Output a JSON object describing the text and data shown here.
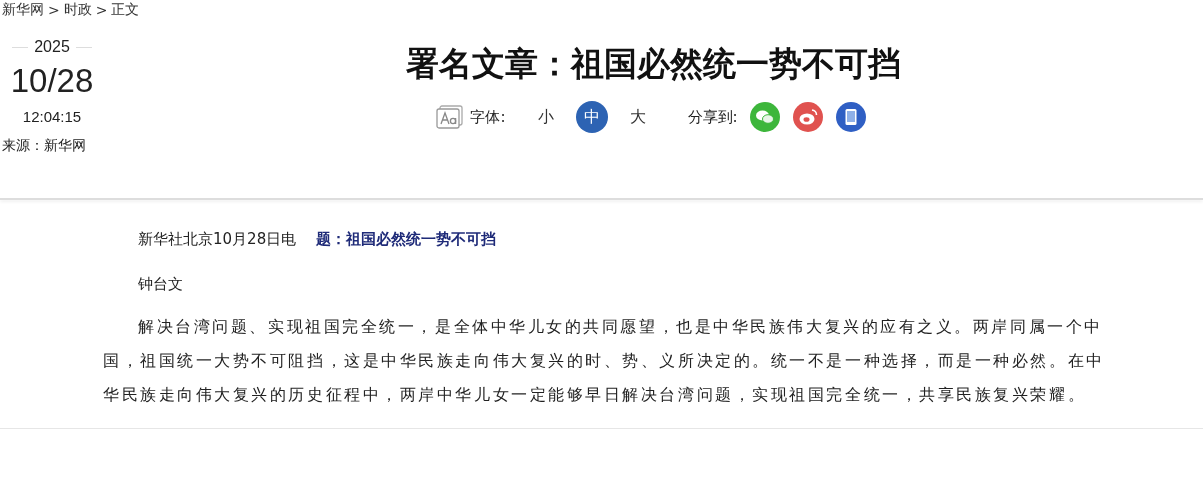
{
  "breadcrumb": [
    "新华网",
    "时政",
    "正文"
  ],
  "breadcrumb_separator": ">",
  "date": {
    "year": "2025",
    "day": "10/28",
    "time": "12:04:15",
    "source": "来源：新华网"
  },
  "title": "署名文章：祖国必然统一势不可挡",
  "font_size": {
    "label": "字体:",
    "options": [
      {
        "label": "小",
        "selected": false
      },
      {
        "label": "中",
        "selected": true
      },
      {
        "label": "大",
        "selected": false
      }
    ]
  },
  "share": {
    "label": "分享到:",
    "targets": [
      {
        "kind": "wechat",
        "color": "#3db63b"
      },
      {
        "kind": "weibo",
        "color": "#e0524f"
      },
      {
        "kind": "mobile",
        "color": "#2f5fc4"
      }
    ]
  },
  "article": {
    "dateline": "新华社北京10月28日电",
    "headline": "题：祖国必然统一势不可挡",
    "author": "钟台文",
    "paragraphs": [
      "解决台湾问题、实现祖国完全统一，是全体中华儿女的共同愿望，也是中华民族伟大复兴的应有之义。两岸同属一个中国，祖国统一大势不可阻挡，这是中华民族走向伟大复兴的时、势、义所决定的。统一不是一种选择，而是一种必然。在中华民族走向伟大复兴的历史征程中，两岸中华儿女一定能够早日解决台湾问题，实现祖国完全统一，共享民族复兴荣耀。"
    ]
  }
}
